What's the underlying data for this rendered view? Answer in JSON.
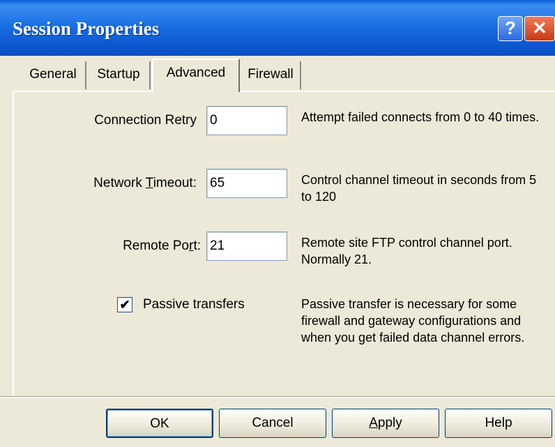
{
  "window": {
    "title": "Session Properties",
    "help_label": "?",
    "close_label": "✕"
  },
  "tabs": [
    {
      "label": "General",
      "active": false
    },
    {
      "label": "Startup",
      "active": false
    },
    {
      "label": "Advanced",
      "active": true
    },
    {
      "label": "Firewall",
      "active": false
    }
  ],
  "connection_retry": {
    "label": "Connection Retry",
    "value": "0",
    "description": "Attempt failed connects from 0 to 40 times."
  },
  "network_timeout": {
    "label_pre": "Network ",
    "label_accel": "T",
    "label_post": "imeout:",
    "value": "65",
    "description": "Control channel timeout in seconds from 5 to 120"
  },
  "remote_port": {
    "label_pre": "Remote Po",
    "label_accel": "r",
    "label_post": "t:",
    "value": "21",
    "description": "Remote site FTP control channel port. Normally 21."
  },
  "passive": {
    "checked": true,
    "check_glyph": "✔",
    "label": "Passive transfers",
    "description": "Passive transfer is necessary for some firewall and gateway configurations and when you get failed data channel errors."
  },
  "buttons": {
    "ok": "OK",
    "cancel": "Cancel",
    "apply_accel": "A",
    "apply_rest": "pply",
    "help": "Help"
  }
}
